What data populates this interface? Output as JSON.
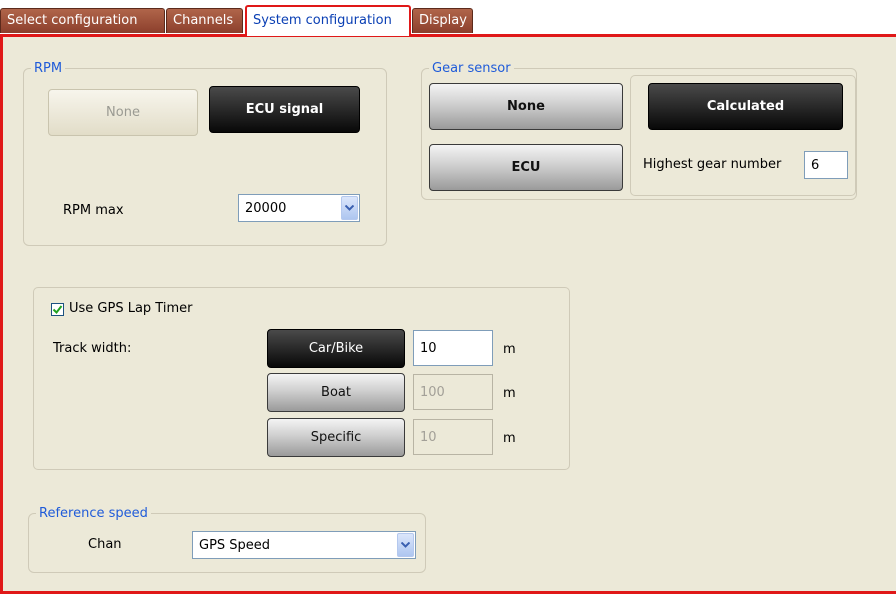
{
  "tabs": [
    {
      "label": "Select configuration"
    },
    {
      "label": "Channels"
    },
    {
      "label": "System configuration"
    },
    {
      "label": "Display"
    }
  ],
  "rpm": {
    "legend": "RPM",
    "none_label": "None",
    "ecu_signal_label": "ECU signal",
    "rpm_max_label": "RPM max",
    "rpm_max_value": "20000"
  },
  "gear": {
    "legend": "Gear sensor",
    "none_label": "None",
    "calculated_label": "Calculated",
    "ecu_label": "ECU",
    "highest_gear_label": "Highest gear number",
    "highest_gear_value": "6"
  },
  "gps": {
    "use_gps_label": "Use GPS Lap Timer",
    "use_gps_checked": true,
    "track_width_label": "Track width:",
    "rows": [
      {
        "button": "Car/Bike",
        "value": "10",
        "unit": "m",
        "active": true
      },
      {
        "button": "Boat",
        "value": "100",
        "unit": "m",
        "active": false
      },
      {
        "button": "Specific",
        "value": "10",
        "unit": "m",
        "active": false
      }
    ]
  },
  "reference": {
    "legend": "Reference speed",
    "chan_label": "Chan",
    "chan_value": "GPS Speed"
  },
  "colors": {
    "accent": "#e01818",
    "legend": "#1f5bd9",
    "tab_bg": "#9a4a34",
    "panel_bg": "#ece9d8"
  },
  "icons": {
    "dropdown": "chevron-down-icon",
    "check": "checkmark-icon"
  }
}
